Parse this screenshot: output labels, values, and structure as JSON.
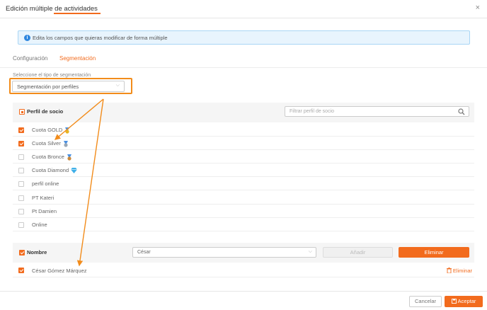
{
  "dialog": {
    "title": "Edición múltiple de actividades",
    "close_glyph": "×"
  },
  "info": {
    "icon": "info-icon",
    "text": "Edita los campos que quieras modificar de forma múltiple"
  },
  "tabs": [
    {
      "label": "Configuración",
      "active": false
    },
    {
      "label": "Segmentación",
      "active": true
    }
  ],
  "segmentation": {
    "label": "Seleccione el tipo de segmentación",
    "value": "Segmentación por perfiles"
  },
  "perfil": {
    "header": "Perfil de socio",
    "filter_placeholder": "Filtrar perfil de socio",
    "items": [
      {
        "label": "Cuota GOLD",
        "checked": true,
        "icon": "gold-medal-icon"
      },
      {
        "label": "Cuota Silver",
        "checked": true,
        "icon": "silver-medal-icon"
      },
      {
        "label": "Cuota Bronce",
        "checked": false,
        "icon": "bronze-medal-icon"
      },
      {
        "label": "Cuota Diamond",
        "checked": false,
        "icon": "diamond-icon"
      },
      {
        "label": "perfil online",
        "checked": false
      },
      {
        "label": "PT Kateri",
        "checked": false
      },
      {
        "label": "Pt Damien",
        "checked": false
      },
      {
        "label": "Online",
        "checked": false
      }
    ]
  },
  "nombre": {
    "header": "Nombre",
    "select_value": "César",
    "add_label": "Añadir",
    "remove_label": "Eliminar",
    "person": "César Gómez Márquez",
    "person_remove": "Eliminar"
  },
  "footer": {
    "cancel": "Cancelar",
    "accept": "Aceptar"
  },
  "colors": {
    "accent": "#f26b1d",
    "highlight": "#f28c1b",
    "info_bg": "#e8f4fd"
  }
}
